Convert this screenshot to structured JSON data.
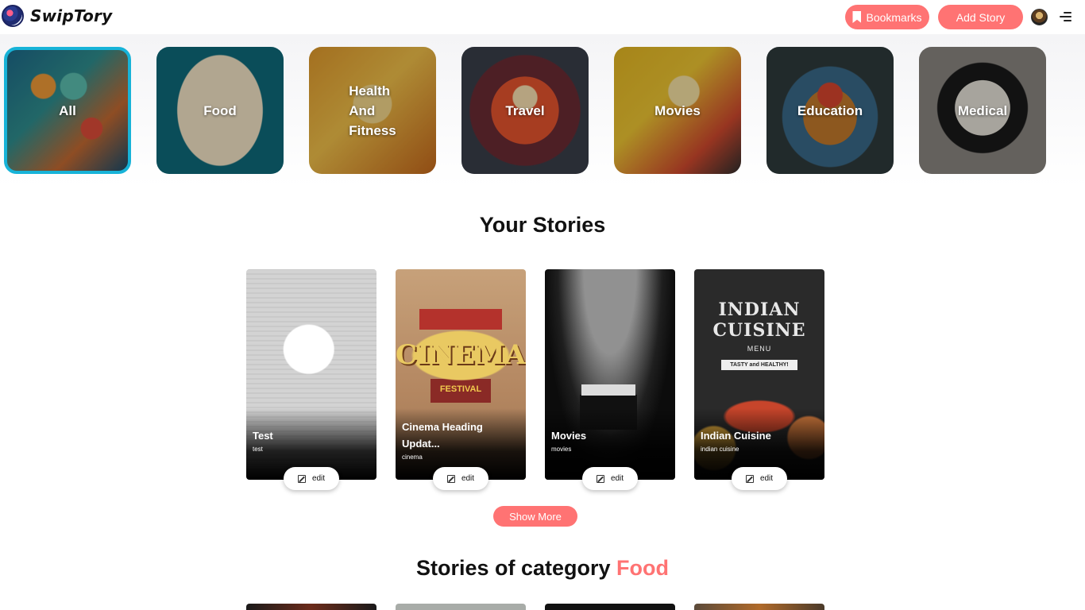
{
  "header": {
    "brand": "SwipTory",
    "bookmarks_label": "Bookmarks",
    "add_story_label": "Add Story",
    "icons": [
      "logo",
      "bookmark-icon",
      "avatar",
      "menu-icon"
    ],
    "accent_color": "#ff7373"
  },
  "categories": [
    {
      "label": "All",
      "selected": true
    },
    {
      "label": "Food",
      "selected": false
    },
    {
      "label": "Health And Fitness",
      "lines": [
        "Health",
        "And",
        "Fitness"
      ],
      "selected": false
    },
    {
      "label": "Travel",
      "selected": false
    },
    {
      "label": "Movies",
      "selected": false
    },
    {
      "label": "Education",
      "selected": false
    },
    {
      "label": "Medical",
      "selected": false
    }
  ],
  "your_stories": {
    "heading": "Your Stories",
    "edit_label": "edit",
    "items": [
      {
        "title": "Test",
        "desc": "test"
      },
      {
        "title": "Cinema Heading Updat...",
        "desc": "cinema",
        "image_text": {
          "headline": "CINEMA",
          "sub": "FESTIVAL"
        }
      },
      {
        "title": "Movies",
        "desc": "movies"
      },
      {
        "title": "Indian Cuisine",
        "desc": "indian cuisine",
        "image_text": {
          "headline": "INDIAN CUISINE",
          "sub": "MENU",
          "banner": "TASTY and HEALTHY!"
        }
      }
    ],
    "show_more_label": "Show More"
  },
  "category_section": {
    "heading_prefix": "Stories of category",
    "heading_category": "Food"
  },
  "colors": {
    "primary_button": "#ff7373",
    "selected_category_border": "#17b3d8"
  }
}
